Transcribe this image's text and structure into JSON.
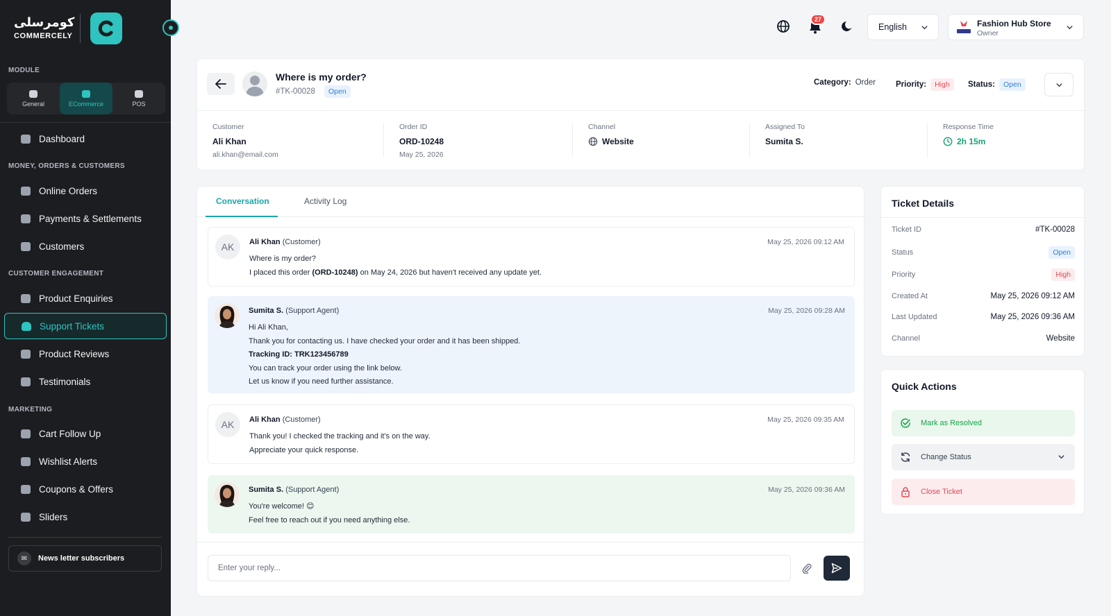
{
  "brand": {
    "arabic": "كومرسلى",
    "name": "COMMERCELY"
  },
  "sidebar": {
    "module_label": "MODULE",
    "module_tabs": [
      {
        "label": "General",
        "icon": "general-icon"
      },
      {
        "label": "ECommerce",
        "icon": "cart-icon"
      },
      {
        "label": "POS",
        "icon": "pos-icon"
      }
    ],
    "dashboard": "Dashboard",
    "section_money": "MONEY, ORDERS & CUSTOMERS",
    "online_orders": "Online Orders",
    "payments": "Payments & Settlements",
    "customers": "Customers",
    "section_engagement": "CUSTOMER ENGAGEMENT",
    "product_enquiries": "Product Enquiries",
    "support_tickets": "Support Tickets",
    "product_reviews": "Product Reviews",
    "testimonials": "Testimonials",
    "section_marketing": "MARKETING",
    "cart_follow_up": "Cart Follow Up",
    "wishlist_alerts": "Wishlist Alerts",
    "coupons": "Coupons & Offers",
    "sliders": "Sliders",
    "newsletter": "News letter subscribers"
  },
  "topbar": {
    "notification_count": "27",
    "language": "English",
    "store_name": "Fashion Hub Store",
    "store_role": "Owner"
  },
  "ticket": {
    "title": "Where is my order?",
    "id": "#TK-00028",
    "status_badge": "Open",
    "category_label": "Category:",
    "category": "Order",
    "priority_label": "Priority:",
    "priority": "High",
    "status_label": "Status:",
    "status": "Open"
  },
  "info": {
    "customer_label": "Customer",
    "customer_name": "Ali Khan",
    "customer_email": "ali.khan@email.com",
    "order_label": "Order ID",
    "order_id": "ORD-10248",
    "order_date": "May 25, 2026",
    "channel_label": "Channel",
    "channel": "Website",
    "assigned_label": "Assigned To",
    "assigned": "Sumita S.",
    "response_label": "Response Time",
    "response": "2h 15m"
  },
  "tabs": {
    "conversation": "Conversation",
    "activity": "Activity Log"
  },
  "messages": [
    {
      "initials": "AK",
      "name": "Ali Khan",
      "role": "(Customer)",
      "time": "May 25, 2026 09:12 AM",
      "line1": "Where is my order?",
      "line2_pre": "I placed this order ",
      "line2_bold": "(ORD-10248)",
      "line2_post": " on May 24, 2026 but haven't received any update yet."
    },
    {
      "name": "Sumita S.",
      "role": "(Support Agent)",
      "time": "May 25, 2026 09:28 AM",
      "line1": "Hi Ali Khan,",
      "line2": "Thank you for contacting us. I have checked your order and it has been shipped.",
      "line3": "Tracking ID: TRK123456789",
      "line4": "You can track your order using the link below.",
      "line5": "Let us know if you need further assistance."
    },
    {
      "initials": "AK",
      "name": "Ali Khan",
      "role": "(Customer)",
      "time": "May 25, 2026 09:35 AM",
      "line1": "Thank you! I checked the tracking and it's on the way.",
      "line2": "Appreciate your quick response."
    },
    {
      "name": "Sumita S.",
      "role": "(Support Agent)",
      "time": "May 25, 2026 09:36 AM",
      "line1": "You're welcome! 😊",
      "line2": "Feel free to reach out if you need anything else."
    }
  ],
  "reply": {
    "placeholder": "Enter your reply..."
  },
  "details": {
    "title": "Ticket Details",
    "ticket_id_label": "Ticket ID",
    "ticket_id": "#TK-00028",
    "status_label": "Status",
    "status": "Open",
    "priority_label": "Priority",
    "priority": "High",
    "created_label": "Created At",
    "created": "May 25, 2026 09:12 AM",
    "updated_label": "Last Updated",
    "updated": "May 25, 2026 09:36 AM",
    "channel_label": "Channel",
    "channel": "Website"
  },
  "quick_actions": {
    "title": "Quick Actions",
    "resolve": "Mark as Resolved",
    "change_status": "Change Status",
    "close": "Close Ticket"
  },
  "colors": {
    "accent": "#2fc4c0",
    "sidebar_bg": "#1c1d20",
    "open": "#2f7fd8",
    "high": "#e04a55",
    "resolved": "#16a34a"
  }
}
